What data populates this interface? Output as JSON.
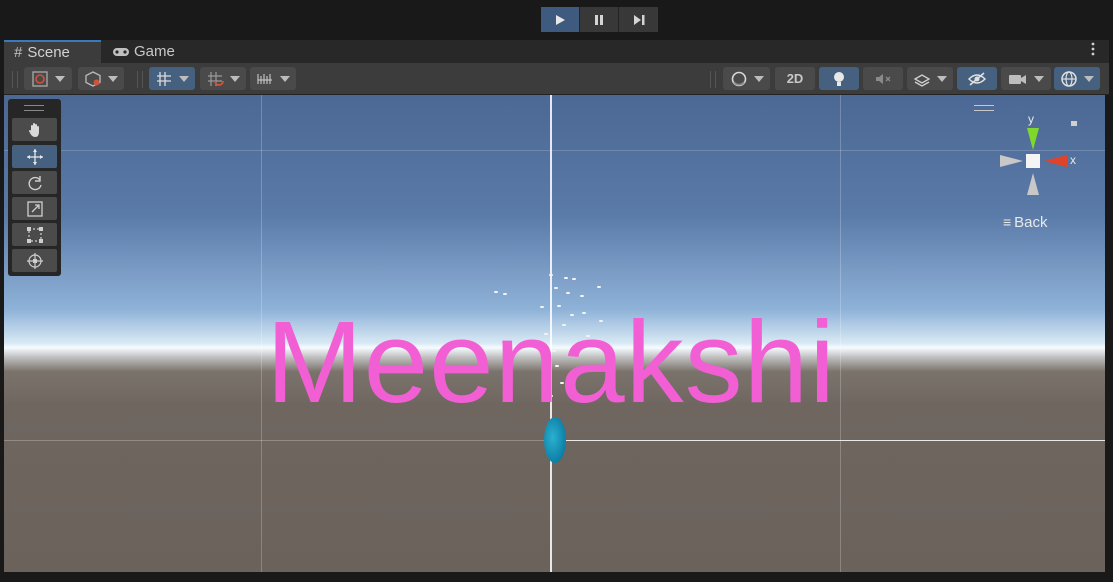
{
  "playbar": {
    "play": "play-icon",
    "pause": "pause-icon",
    "step": "step-icon"
  },
  "tabs": [
    {
      "label": "Scene",
      "icon": "grid-icon"
    },
    {
      "label": "Game",
      "icon": "gamepad-icon"
    }
  ],
  "toolbar": {
    "two_d_label": "2D"
  },
  "viewport": {
    "text": "Meenakshi",
    "text_color": "#f25fd4"
  },
  "gizmo": {
    "y_label": "y",
    "x_label": "x",
    "view_label": "Back"
  },
  "colors": {
    "accent": "#3a79bb",
    "active_button": "#46607f",
    "capsule": "#1a9cc4"
  }
}
